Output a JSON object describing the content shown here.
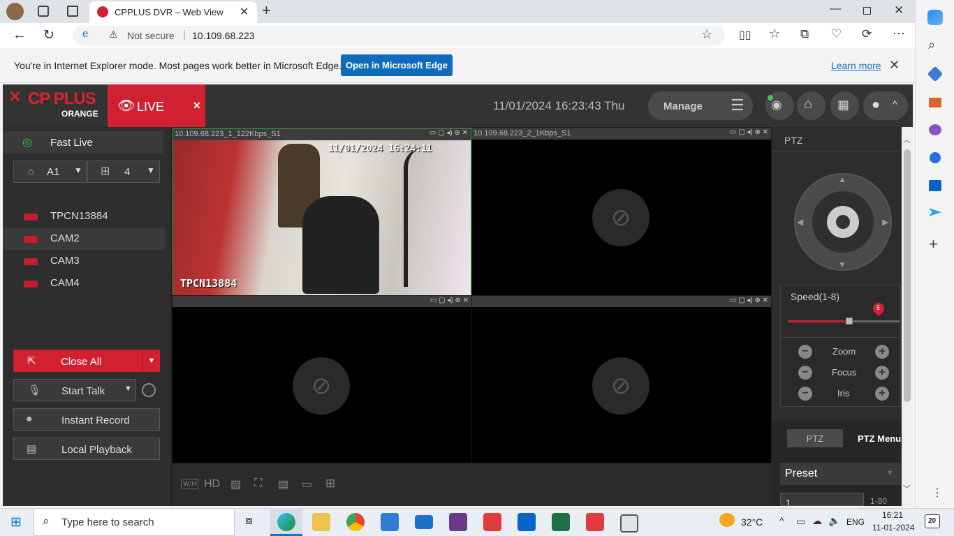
{
  "browser": {
    "tab_title": "CPPLUS DVR – Web View",
    "not_secure": "Not secure",
    "url": "10.109.68.223",
    "ie_message": "You're in Internet Explorer mode. Most pages work better in Microsoft Edge.",
    "open_edge_label": "Open in Microsoft Edge",
    "learn_more": "Learn more"
  },
  "dvr": {
    "logo_text": "CP PLUS",
    "logo_sub": "ORANGE",
    "live_tab": "LIVE",
    "datetime": "11/01/2024 16:23:43 Thu",
    "manage_label": "Manage"
  },
  "left": {
    "fast_live": "Fast Live",
    "group": "A1",
    "split": "4",
    "channels": [
      "TPCN13884",
      "CAM2",
      "CAM3",
      "CAM4"
    ],
    "close_all": "Close All",
    "start_talk": "Start Talk",
    "instant_record": "Instant Record",
    "local_playback": "Local Playback"
  },
  "tiles": {
    "t1_header": "10.109.68.223_1_122Kbps_S1",
    "t2_header": "10.109.68.223_2_1Kbps_S1",
    "t1_timestamp": "11/01/2024 16:24:11",
    "t1_label": "TPCN13884"
  },
  "bottombar": {
    "wh": "W:H",
    "hd": "HD"
  },
  "ptz": {
    "title": "PTZ",
    "speed_label": "Speed(1-8)",
    "speed_value": "5",
    "zoom": "Zoom",
    "focus": "Focus",
    "iris": "Iris",
    "tab_ptz": "PTZ",
    "tab_menu": "PTZ Menu",
    "preset": "Preset",
    "preset_value": "1",
    "preset_range": "1-80"
  },
  "taskbar": {
    "search_placeholder": "Type here to search",
    "temperature": "32°C",
    "lang": "ENG",
    "time": "16:21",
    "date": "11-01-2024",
    "notification_count": "20"
  }
}
